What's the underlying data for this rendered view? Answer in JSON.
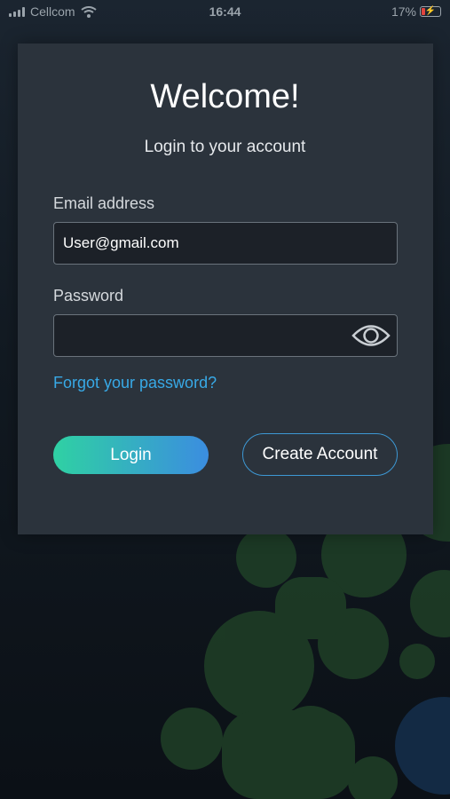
{
  "status_bar": {
    "carrier": "Cellcom",
    "time": "16:44",
    "battery": "17%"
  },
  "login": {
    "title": "Welcome!",
    "subtitle": "Login to your account",
    "email_label": "Email address",
    "email_value": "User@gmail.com",
    "password_label": "Password",
    "password_value": "",
    "forgot_link": "Forgot your password?",
    "login_button": "Login",
    "create_account_button": "Create Account"
  },
  "icons": [
    "signal-icon",
    "wifi-icon",
    "battery-icon",
    "eye-icon"
  ],
  "colors": {
    "card_bg": "#2b333c",
    "link": "#38a9e6",
    "login_gradient_start": "#2fd1a3",
    "login_gradient_end": "#3b8de0",
    "create_border": "#3d98d4"
  }
}
